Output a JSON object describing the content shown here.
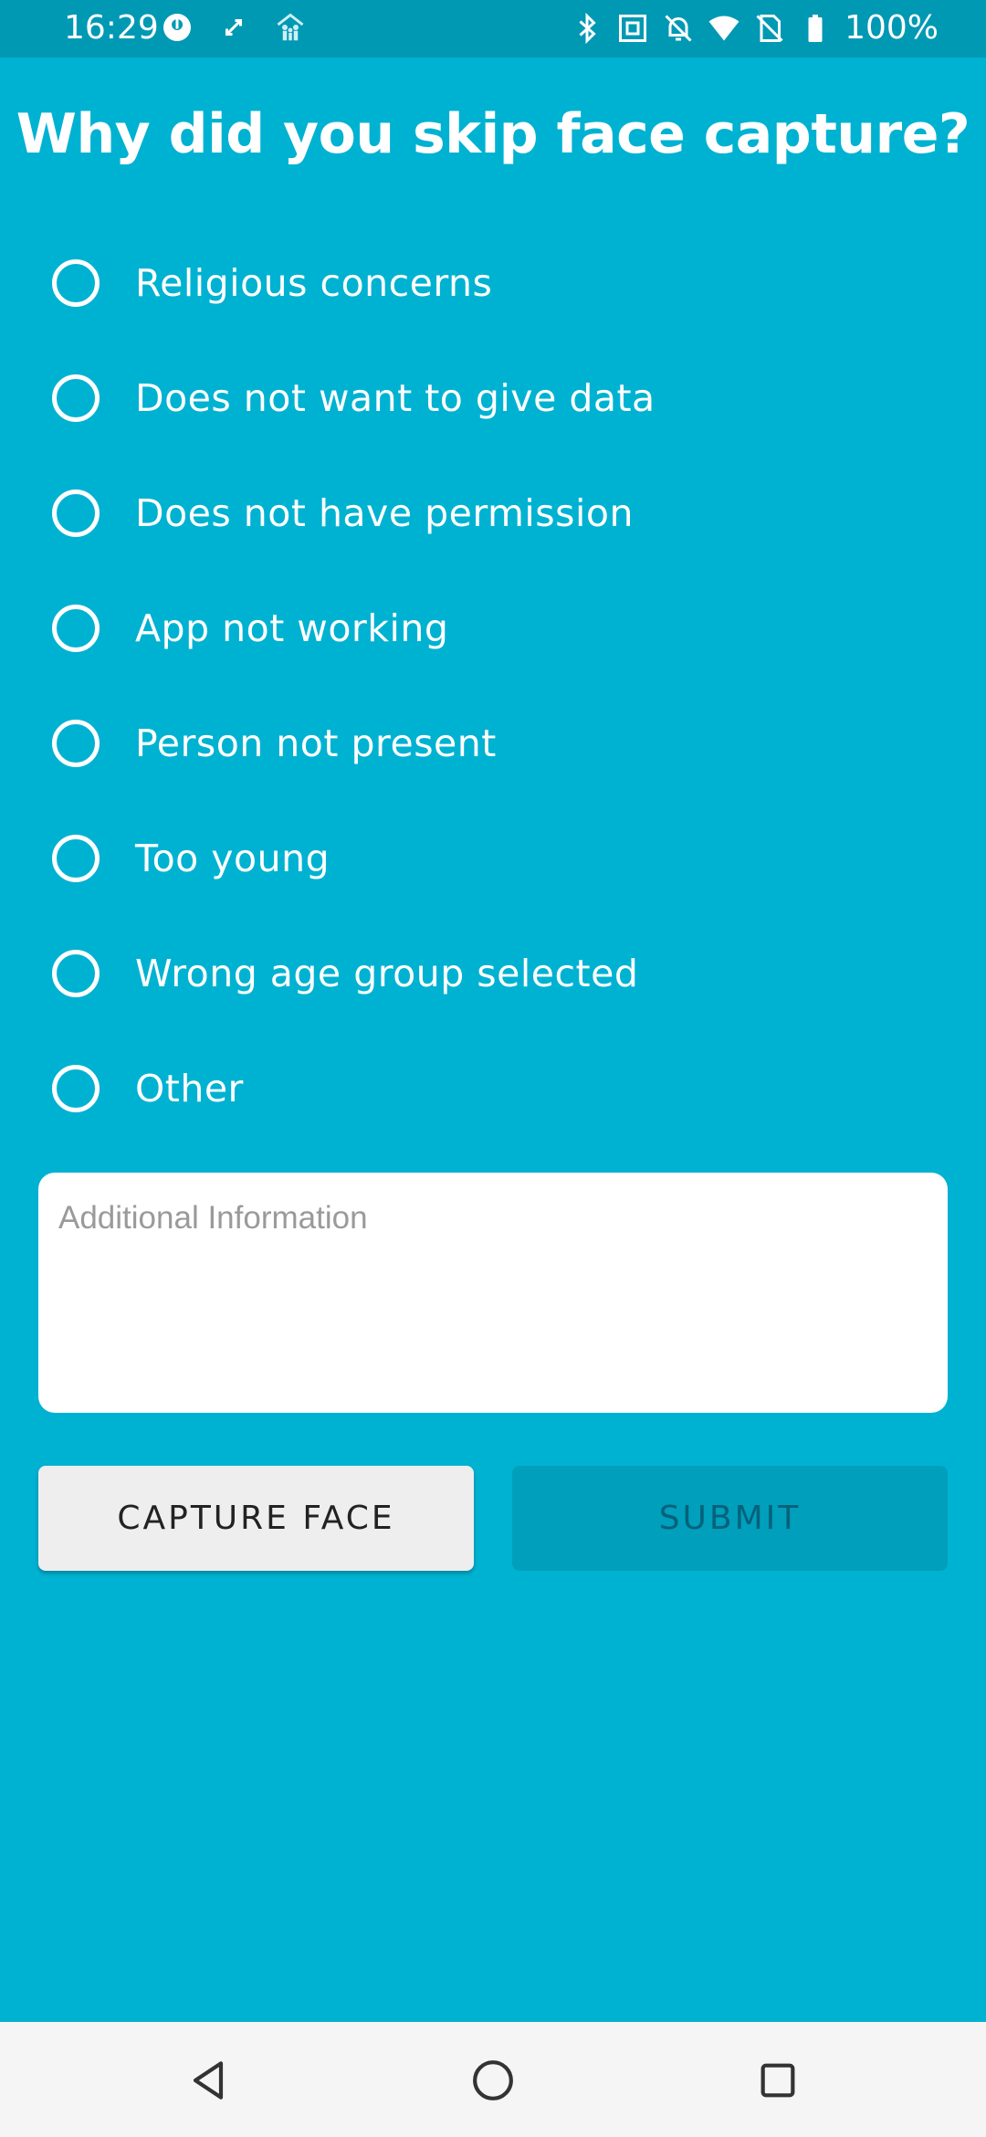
{
  "status_bar": {
    "time": "16:29",
    "battery": "100%",
    "icons": [
      "app-notification-icon",
      "sync-icon",
      "family-icon",
      "bluetooth-icon",
      "nfc-icon",
      "bell-off-icon",
      "wifi-icon",
      "no-sim-icon",
      "battery-icon"
    ]
  },
  "title": "Why did you skip face capture?",
  "options": [
    {
      "label": "Religious concerns",
      "selected": false
    },
    {
      "label": "Does not want to give data",
      "selected": false
    },
    {
      "label": "Does not have permission",
      "selected": false
    },
    {
      "label": "App not working",
      "selected": false
    },
    {
      "label": "Person not present",
      "selected": false
    },
    {
      "label": "Too young",
      "selected": false
    },
    {
      "label": "Wrong age group selected",
      "selected": false
    },
    {
      "label": "Other",
      "selected": false
    }
  ],
  "additional_info": {
    "placeholder": "Additional Information",
    "value": ""
  },
  "buttons": {
    "capture_face": "CAPTURE FACE",
    "submit": "SUBMIT"
  },
  "colors": {
    "background": "#00B2D2",
    "status_bar": "#0099B4",
    "submit_disabled": "#009FBC"
  },
  "nav_bar": {
    "icons": [
      "back-icon",
      "home-icon",
      "recents-icon"
    ]
  }
}
